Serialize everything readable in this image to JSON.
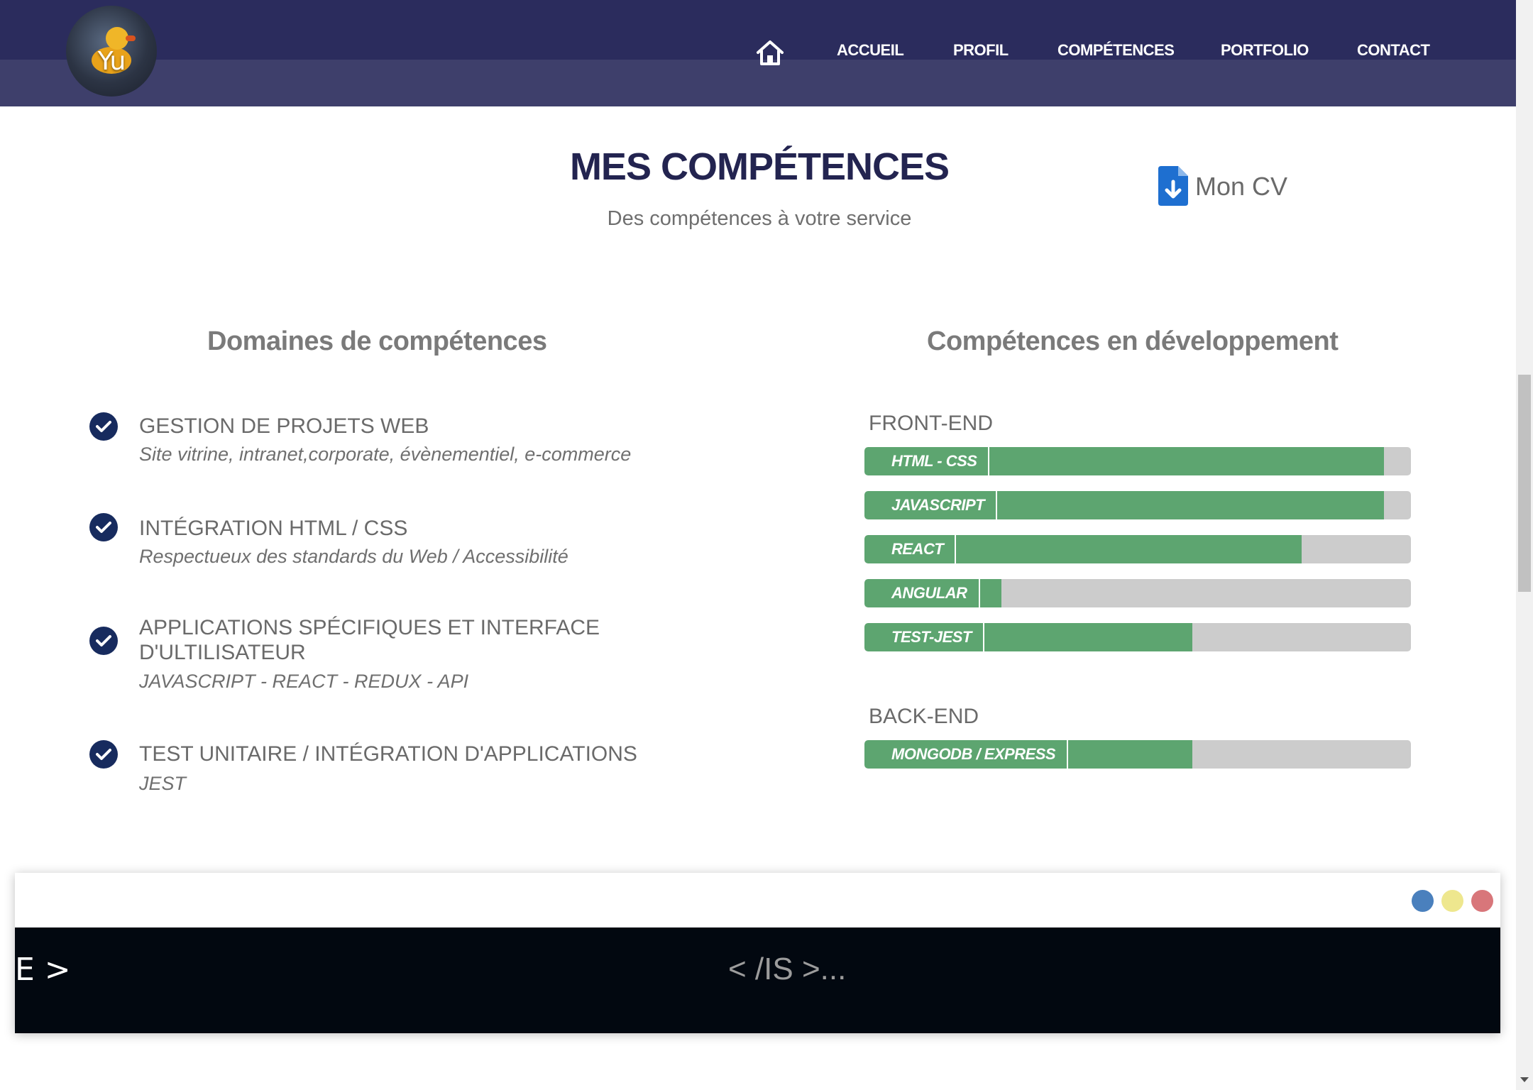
{
  "header": {
    "logo_text": "Yu",
    "nav": [
      {
        "label": "ACCUEIL"
      },
      {
        "label": "PROFIL"
      },
      {
        "label": "COMPÉTENCES"
      },
      {
        "label": "PORTFOLIO"
      },
      {
        "label": "CONTACT"
      }
    ]
  },
  "section": {
    "title": "MES COMPÉTENCES",
    "subtitle": "Des compétences à votre service",
    "cv_label": "Mon CV"
  },
  "domains": {
    "title": "Domaines de compétences",
    "items": [
      {
        "title": "GESTION DE PROJETS WEB",
        "desc": "Site vitrine, intranet,corporate, évènementiel, e-commerce"
      },
      {
        "title": "INTÉGRATION HTML / CSS",
        "desc": "Respectueux des standards du Web / Accessibilité"
      },
      {
        "title": "APPLICATIONS SPÉCIFIQUES ET INTERFACE D'ULTILISATEUR",
        "desc": "JAVASCRIPT - REACT - REDUX - API"
      },
      {
        "title": "TEST UNITAIRE / INTÉGRATION D'APPLICATIONS",
        "desc": "JEST"
      }
    ]
  },
  "dev": {
    "title": "Compétences en développement",
    "front_label": "FRONT-END",
    "back_label": "BACK-END",
    "front": [
      {
        "label": "HTML - CSS",
        "percent": 95
      },
      {
        "label": "JAVASCRIPT",
        "percent": 95
      },
      {
        "label": "REACT",
        "percent": 80
      },
      {
        "label": "ANGULAR",
        "percent": 25
      },
      {
        "label": "TEST-JEST",
        "percent": 60
      }
    ],
    "back": [
      {
        "label": "MONGODB / EXPRESS",
        "percent": 60
      }
    ]
  },
  "terminal": {
    "left_text": "E >",
    "center_text": "< /IS >...",
    "dot_colors": [
      "#4a80bd",
      "#eee78e",
      "#d8767a"
    ]
  },
  "colors": {
    "header_bg": "#2b2c5d",
    "title": "#232450",
    "bar_fill": "#5da570",
    "bar_track": "#cccccc",
    "check_bg": "#172b5e",
    "cv_icon": "#1e6fd0"
  }
}
